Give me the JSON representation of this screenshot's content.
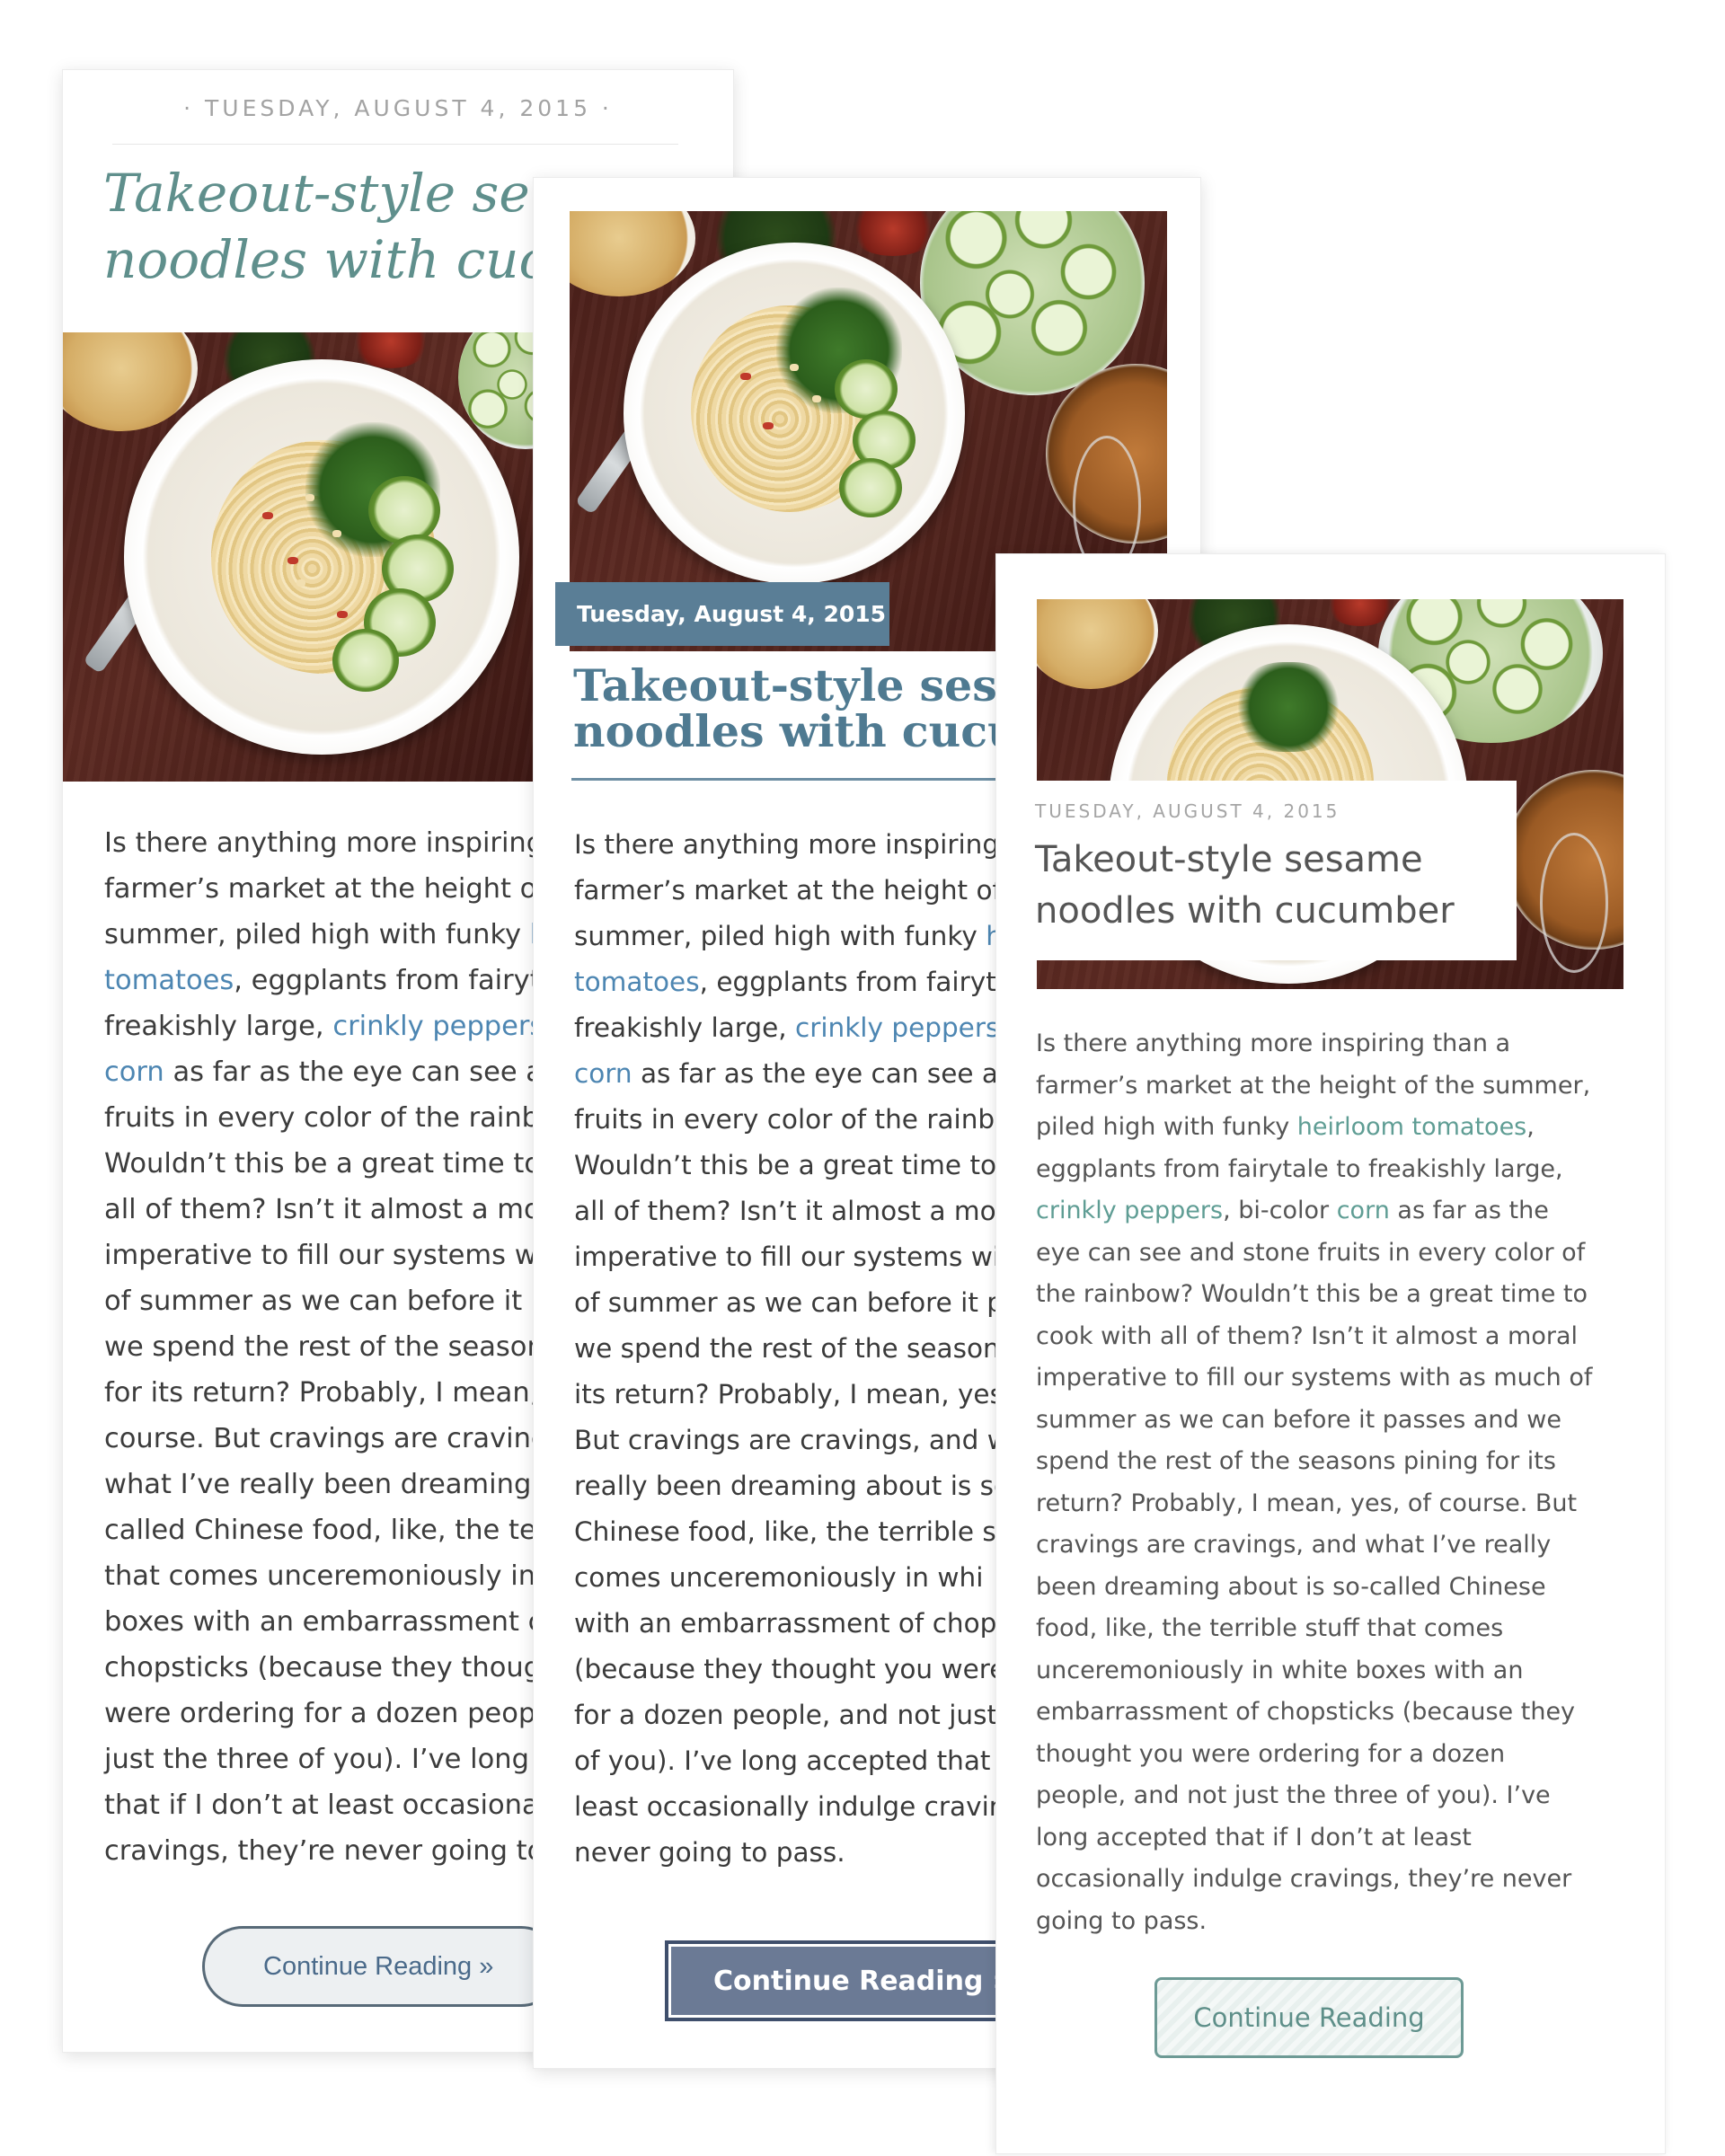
{
  "colors": {
    "card1_title": "#5f8f8c",
    "card1_link": "#4d86b2",
    "card2_date_bg": "#5a7e96",
    "card2_title": "#4f7a91",
    "card2_button_bg": "#6b7a95",
    "card3_link": "#5f9d94",
    "card3_button_border": "#6d9a95"
  },
  "card1": {
    "date": "· TUESDAY, AUGUST 4, 2015 ·",
    "title_line1": "Takeout-style se",
    "title_line2": "noodles with cucu",
    "image_alt": "bowl of sesame noodles with cucumber",
    "body": [
      {
        "pre": "Is there anything more inspiring",
        "link": "",
        "post": ""
      },
      {
        "pre": "farmer’s market at the height of",
        "link": "",
        "post": ""
      },
      {
        "pre": "summer, piled high with funky ",
        "link": "h",
        "post": ""
      },
      {
        "pre": "",
        "link": "tomatoes",
        "post": ", eggplants from fairyt"
      },
      {
        "pre": "freakishly large, ",
        "link": "crinkly peppers",
        "post": ""
      },
      {
        "pre": "",
        "link": "corn",
        "post": " as far as the eye can see a"
      },
      {
        "pre": "fruits in every color of the rainb",
        "link": "",
        "post": ""
      },
      {
        "pre": "Wouldn’t this be a great time to",
        "link": "",
        "post": ""
      },
      {
        "pre": "all of them? Isn’t it almost a mor",
        "link": "",
        "post": ""
      },
      {
        "pre": "imperative to fill our systems wi",
        "link": "",
        "post": ""
      },
      {
        "pre": "of summer as we can before it p",
        "link": "",
        "post": ""
      },
      {
        "pre": "we spend the rest of the season",
        "link": "",
        "post": ""
      },
      {
        "pre": "for its return? Probably, I mean,",
        "link": "",
        "post": ""
      },
      {
        "pre": "course. But cravings are craving",
        "link": "",
        "post": ""
      },
      {
        "pre": "what I’ve really been dreaming a",
        "link": "",
        "post": ""
      },
      {
        "pre": "called Chinese food, like, the ter",
        "link": "",
        "post": ""
      },
      {
        "pre": "that comes unceremoniously in",
        "link": "",
        "post": ""
      },
      {
        "pre": "boxes with an embarrassment c",
        "link": "",
        "post": ""
      },
      {
        "pre": "chopsticks (because they thougl",
        "link": "",
        "post": ""
      },
      {
        "pre": "were ordering for a dozen peop",
        "link": "",
        "post": ""
      },
      {
        "pre": "just the three of you). I’ve long a",
        "link": "",
        "post": ""
      },
      {
        "pre": "that if I don’t at least occasional",
        "link": "",
        "post": ""
      },
      {
        "pre": "cravings, they’re never going to",
        "link": "",
        "post": ""
      }
    ],
    "button": "Continue Reading »"
  },
  "card2": {
    "date": "Tuesday, August 4, 2015",
    "title_line1": "Takeout-style sesar",
    "title_line2": "noodles with cucur",
    "image_alt": "bowl of sesame noodles with cucumber",
    "body": [
      {
        "pre": "Is there anything more inspiring",
        "link": "",
        "post": ""
      },
      {
        "pre": "farmer’s market at the height of",
        "link": "",
        "post": ""
      },
      {
        "pre": "summer, piled high with funky ",
        "link": "h",
        "post": ""
      },
      {
        "pre": "",
        "link": "tomatoes",
        "post": ", eggplants from fairyt"
      },
      {
        "pre": "freakishly large, ",
        "link": "crinkly peppers",
        "post": ","
      },
      {
        "pre": "",
        "link": "corn",
        "post": " as far as the eye can see a"
      },
      {
        "pre": "fruits in every color of the rainb",
        "link": "",
        "post": ""
      },
      {
        "pre": "Wouldn’t this be a great time to",
        "link": "",
        "post": ""
      },
      {
        "pre": "all of them? Isn’t it almost a mor",
        "link": "",
        "post": ""
      },
      {
        "pre": "imperative to fill our systems wi",
        "link": "",
        "post": ""
      },
      {
        "pre": "of summer as we can before it p",
        "link": "",
        "post": ""
      },
      {
        "pre": "we spend the rest of the season",
        "link": "",
        "post": ""
      },
      {
        "pre": "its return? Probably, I mean, yes",
        "link": "",
        "post": ""
      },
      {
        "pre": "But cravings are cravings, and w",
        "link": "",
        "post": ""
      },
      {
        "pre": "really been dreaming about is sc",
        "link": "",
        "post": ""
      },
      {
        "pre": "Chinese food, like, the terrible s",
        "link": "",
        "post": ""
      },
      {
        "pre": "comes unceremoniously in whi",
        "link": "",
        "post": ""
      },
      {
        "pre": "with an embarrassment of chop",
        "link": "",
        "post": ""
      },
      {
        "pre": "(because they thought you were",
        "link": "",
        "post": ""
      },
      {
        "pre": "for a dozen people, and not just",
        "link": "",
        "post": ""
      },
      {
        "pre": "of you). I’ve long accepted that",
        "link": "",
        "post": ""
      },
      {
        "pre": "least occasionally indulge cravir",
        "link": "",
        "post": ""
      },
      {
        "pre": "never going to pass.",
        "link": "",
        "post": ""
      }
    ],
    "button": "Continue Reading »"
  },
  "card3": {
    "date": "TUESDAY, AUGUST 4, 2015",
    "title": "Takeout-style sesame noodles with cucumber",
    "image_alt": "bowl of sesame noodles with cucumber",
    "body": [
      {
        "pre": "Is there anything more inspiring than a",
        "link": "",
        "post": ""
      },
      {
        "pre": "farmer’s market at the height of the summer,",
        "link": "",
        "post": ""
      },
      {
        "pre": "piled high with funky ",
        "link": "heirloom tomatoes",
        "post": ","
      },
      {
        "pre": "eggplants from fairytale to freakishly large,",
        "link": "",
        "post": ""
      },
      {
        "pre": "",
        "link": "crinkly peppers",
        "post": ", bi-color ",
        "link2": "corn",
        "post2": " as far as the"
      },
      {
        "pre": "eye can see and stone fruits in every color of",
        "link": "",
        "post": ""
      },
      {
        "pre": "the rainbow? Wouldn’t this be a great time to",
        "link": "",
        "post": ""
      },
      {
        "pre": "cook with all of them? Isn’t it almost a moral",
        "link": "",
        "post": ""
      },
      {
        "pre": "imperative to fill our systems with as much of",
        "link": "",
        "post": ""
      },
      {
        "pre": "summer as we can before it passes and we",
        "link": "",
        "post": ""
      },
      {
        "pre": "spend the rest of the seasons pining for its",
        "link": "",
        "post": ""
      },
      {
        "pre": "return? Probably, I mean, yes, of course. But",
        "link": "",
        "post": ""
      },
      {
        "pre": "cravings are cravings, and what I’ve really",
        "link": "",
        "post": ""
      },
      {
        "pre": "been dreaming about is so-called Chinese",
        "link": "",
        "post": ""
      },
      {
        "pre": "food, like, the terrible stuff that comes",
        "link": "",
        "post": ""
      },
      {
        "pre": "unceremoniously in white boxes with an",
        "link": "",
        "post": ""
      },
      {
        "pre": "embarrassment of chopsticks (because they",
        "link": "",
        "post": ""
      },
      {
        "pre": "thought you were ordering for a dozen",
        "link": "",
        "post": ""
      },
      {
        "pre": "people, and not just the three of you). I’ve",
        "link": "",
        "post": ""
      },
      {
        "pre": "long accepted that if I don’t at least",
        "link": "",
        "post": ""
      },
      {
        "pre": "occasionally indulge cravings, they’re never",
        "link": "",
        "post": ""
      },
      {
        "pre": "going to pass.",
        "link": "",
        "post": ""
      }
    ],
    "button": "Continue Reading"
  }
}
